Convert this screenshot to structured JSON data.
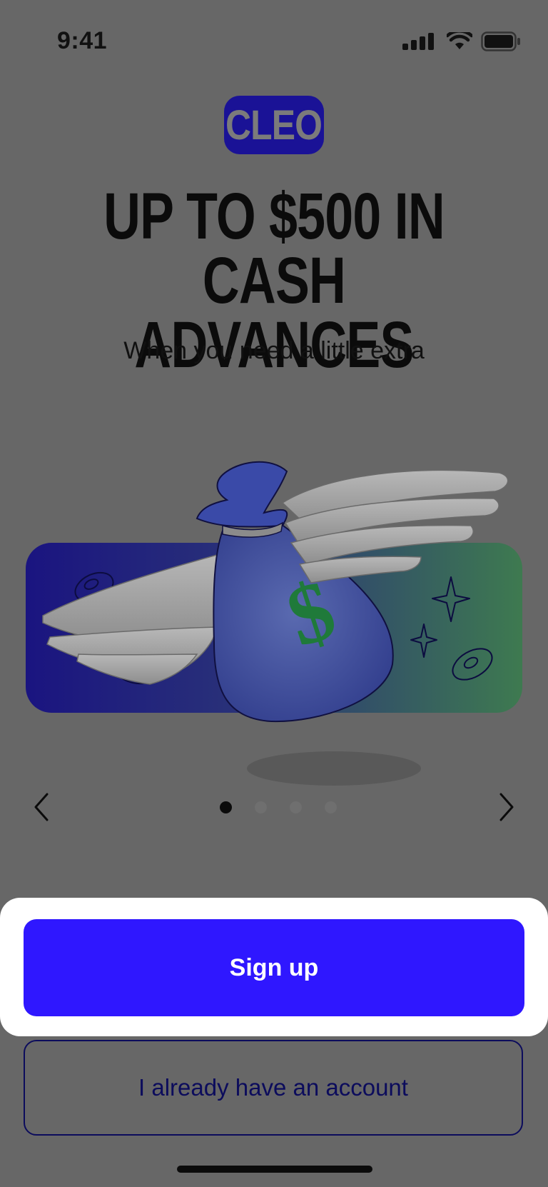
{
  "status_bar": {
    "time": "9:41"
  },
  "logo": {
    "text": "CLEO"
  },
  "headline": {
    "line1": "UP TO $500 IN",
    "line2": "CASH ADVANCES"
  },
  "subtitle": "When you need a little extra",
  "carousel": {
    "page_count": 4,
    "active_index": 0
  },
  "buttons": {
    "signup": "Sign up",
    "login": "I already have an account"
  },
  "colors": {
    "brand": "#2f17ff",
    "logo_bg": "#1a1296",
    "overlay": "#676767"
  }
}
